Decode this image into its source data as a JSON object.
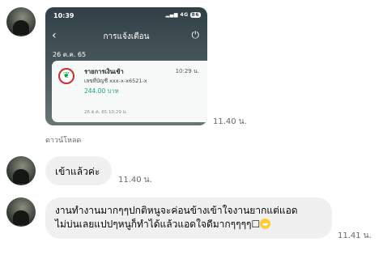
{
  "messages": {
    "image_message": {
      "status_time": "10:39",
      "status_right": "4G",
      "battery": "86",
      "nav_title": "การแจ้งเตือน",
      "date_header": "26 ต.ค. 65",
      "card": {
        "title": "รายการเงินเข้า",
        "time": "10:29 น.",
        "account": "เลขที่บัญชี xxx-x-x6521-x",
        "amount": "244.00 บาท",
        "date": "26 ต.ค. 65 10:29 น."
      },
      "timestamp": "11.40 น.",
      "download_label": "ดาวน์โหลด"
    },
    "short_message": {
      "text": "เข้าแล้วค่ะ",
      "timestamp": "11.40 น."
    },
    "long_message": {
      "line1": "งานทำงานมากๆๆปกติหนูจะค่อนข้างเข้าใจงานยากแต่แอด",
      "line2": "ไม่บ่นเลยแปปๆหนูก็ทำได้แล้วแอดใจดีมากๆๆๆๆ☐",
      "timestamp": "11.41 น."
    }
  }
}
